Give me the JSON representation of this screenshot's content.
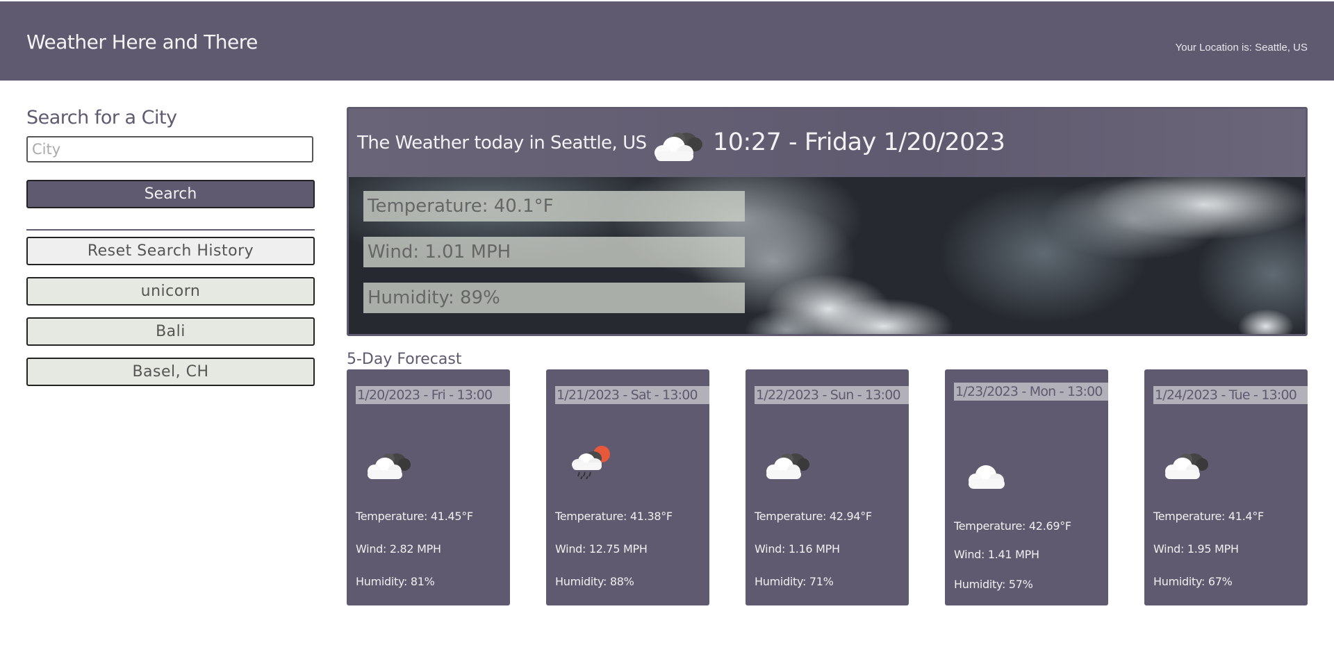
{
  "header": {
    "title": "Weather Here and There",
    "location": "Your Location is: Seattle, US"
  },
  "sidebar": {
    "title": "Search for a City",
    "input_placeholder": "City",
    "search_label": "Search",
    "reset_label": "Reset Search History",
    "history": [
      "unicorn",
      "Bali",
      "Basel, CH"
    ]
  },
  "current": {
    "title": "The Weather today in Seattle, US",
    "icon": "cloudy-icon",
    "time": "10:27 - Friday 1/20/2023",
    "temperature": "Temperature: 40.1°F",
    "wind": "Wind: 1.01 MPH",
    "humidity": "Humidity: 89%"
  },
  "forecast": {
    "title": "5-Day Forecast",
    "days": [
      {
        "date": "1/20/2023 - Fri - 13:00",
        "icon": "cloudy-icon",
        "temperature": "Temperature: 41.45°F",
        "wind": "Wind: 2.82 MPH",
        "humidity": "Humidity: 81%"
      },
      {
        "date": "1/21/2023 - Sat - 13:00",
        "icon": "rain-sun-icon",
        "temperature": "Temperature: 41.38°F",
        "wind": "Wind: 12.75 MPH",
        "humidity": "Humidity: 88%"
      },
      {
        "date": "1/22/2023 - Sun - 13:00",
        "icon": "cloudy-icon",
        "temperature": "Temperature: 42.94°F",
        "wind": "Wind: 1.16 MPH",
        "humidity": "Humidity: 71%"
      },
      {
        "date": "1/23/2023 - Mon - 13:00",
        "icon": "cloud-icon",
        "temperature": "Temperature: 42.69°F",
        "wind": "Wind: 1.41 MPH",
        "humidity": "Humidity: 57%"
      },
      {
        "date": "1/24/2023 - Tue - 13:00",
        "icon": "cloudy-icon",
        "temperature": "Temperature: 41.4°F",
        "wind": "Wind: 1.95 MPH",
        "humidity": "Humidity: 67%"
      }
    ]
  },
  "colors": {
    "primary": "#5f5a6f",
    "history_button_bg": "#e5e9e1",
    "date_highlight": "#b2b0b8"
  }
}
